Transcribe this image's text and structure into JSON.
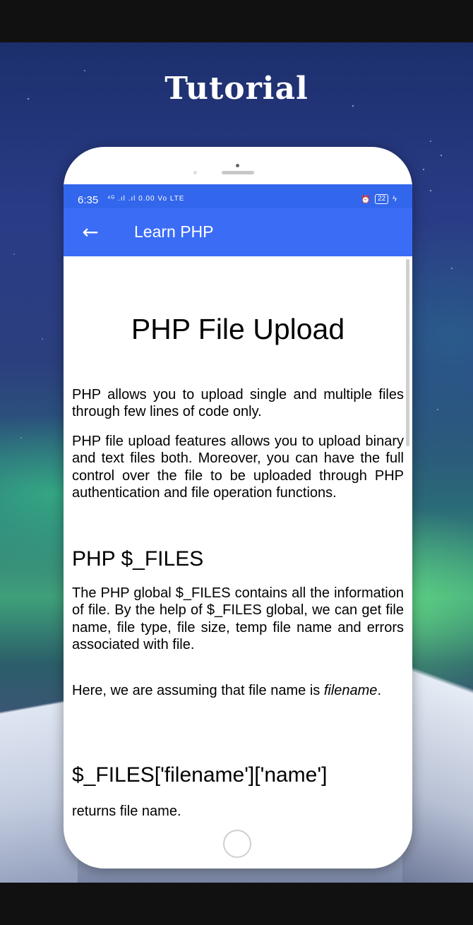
{
  "banner": {
    "title": "Tutorial"
  },
  "status_bar": {
    "time": "6:35",
    "network_icons": "⁴ᴳ .ıl .ıl 0.00 Vo LTE",
    "alarm_icon": "alarm-icon",
    "battery_level": "22"
  },
  "app_bar": {
    "back_icon": "back-arrow-icon",
    "title": "Learn PHP"
  },
  "article": {
    "title": "PHP File Upload",
    "intro_1": "PHP allows you to upload single and multiple files through few lines of code only.",
    "intro_2": "PHP file upload features allows you to upload binary and text files both. Moreover, you can have the full control over the file to be uploaded through PHP authentication and file operation functions.",
    "section_heading": "PHP $_FILES",
    "section_text": "The PHP global $_FILES contains all the information of file. By the help of $_FILES global, we can get file name, file type, file size, temp file name and errors associated with file.",
    "assume_prefix": "Here, we are assuming that file name is ",
    "assume_italic": "filename",
    "assume_suffix": ".",
    "subsection_heading": "$_FILES['filename']['name']",
    "subsection_text": "returns file name."
  },
  "colors": {
    "status_bar": "#3266ec",
    "app_bar": "#3b6cf6"
  }
}
